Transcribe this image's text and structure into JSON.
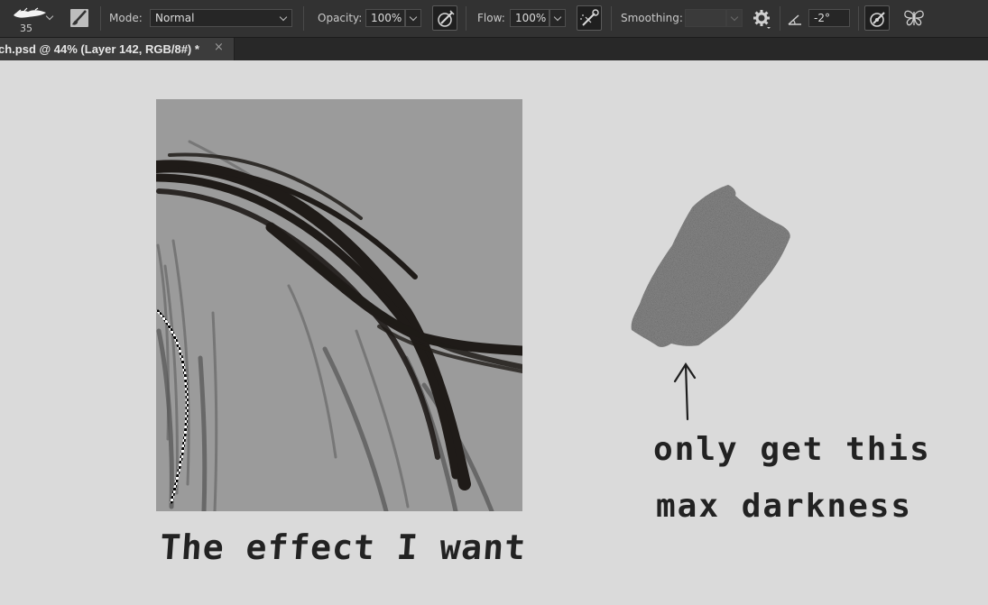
{
  "options_bar": {
    "brush_size": "35",
    "mode_label": "Mode:",
    "mode_value": "Normal",
    "opacity_label": "Opacity:",
    "opacity_value": "100%",
    "flow_label": "Flow:",
    "flow_value": "100%",
    "smoothing_label": "Smoothing:",
    "smoothing_value": "",
    "angle_value": "-2°",
    "icons": [
      "brush-preset-icon",
      "brush-panel-icon",
      "pressure-opacity-icon",
      "airbrush-icon",
      "smoothing-settings-icon",
      "angle-icon",
      "pressure-size-icon",
      "symmetry-icon"
    ]
  },
  "document_tab": {
    "title": "ch.psd @ 44% (Layer 142, RGB/8#) *",
    "close_glyph": "×"
  },
  "canvas": {
    "caption_left": "The effect I want",
    "caption_right_line1": "only get this",
    "caption_right_line2": "max darkness",
    "arrow_glyph": "↑"
  },
  "colors": {
    "toolbar_bg": "#323232",
    "canvas_bg": "#dadada",
    "sample_bg": "#999999",
    "ink": "#1f1b18"
  }
}
